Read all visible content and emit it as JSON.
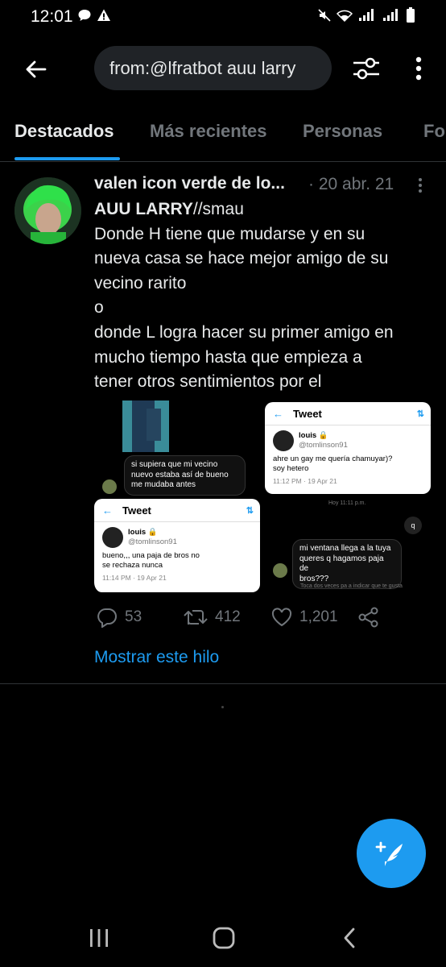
{
  "status_bar": {
    "time": "12:01"
  },
  "search": {
    "query": "from:@lfratbot auu larry"
  },
  "tabs": [
    {
      "label": "Destacados"
    },
    {
      "label": "Más recientes"
    },
    {
      "label": "Personas"
    },
    {
      "label": "Fo"
    }
  ],
  "tweet": {
    "author": "valen icon verde de lo...",
    "date": "· 20 abr. 21",
    "text_lines": [
      {
        "bold": "AUU LARRY",
        "rest": "//smau"
      },
      {
        "text": "Donde H tiene que mudarse y en su"
      },
      {
        "text": "nueva casa se hace mejor amigo de su"
      },
      {
        "text": "vecino rarito"
      },
      {
        "text": "o"
      },
      {
        "text": "donde L logra hacer su primer amigo en"
      },
      {
        "text": "mucho tiempo hasta que empieza a"
      },
      {
        "text": "tener otros sentimientos por el"
      }
    ],
    "media": {
      "chat1": [
        "si supiera que mi vecino",
        "nuevo estaba así de bueno",
        "me mudaba antes"
      ],
      "card1": {
        "title": "Tweet",
        "name": "louis 🔒",
        "handle": "@tomlinson91",
        "text": [
          "ahre un gay me quería chamuyar)?",
          "soy hetero"
        ],
        "time": "11:12 PM · 19 Apr 21"
      },
      "hoy": "Hoy 11:11 p.m.",
      "q": "q",
      "card2": {
        "title": "Tweet",
        "name": "louis 🔒",
        "handle": "@tomlinson91",
        "text": [
          "bueno,,, una paja de bros no",
          "se rechaza nunca"
        ],
        "time": "11:14 PM · 19 Apr 21"
      },
      "chat2": [
        "mi ventana llega a la tuya",
        "queres q hagamos paja de",
        "bros???"
      ],
      "hint": "Toca dos veces pa a indicar que te gusta"
    },
    "actions": {
      "replies": "53",
      "retweets": "412",
      "likes": "1,201"
    },
    "show_thread": "Mostrar este hilo"
  },
  "colors": {
    "accent": "#1d9bf0",
    "background": "#000000",
    "muted": "#71767b"
  },
  "icons": [
    "back-arrow-icon",
    "filter-sliders-icon",
    "more-vertical-icon",
    "reply-icon",
    "retweet-icon",
    "heart-icon",
    "share-icon",
    "compose-quill-icon"
  ]
}
